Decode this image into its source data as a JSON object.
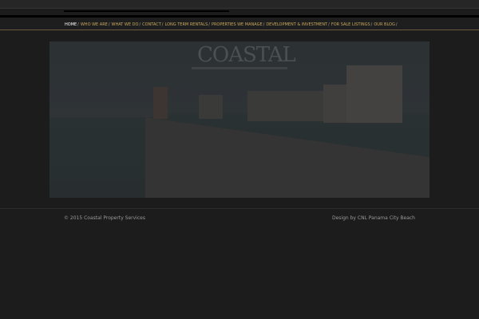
{
  "nav": {
    "items": [
      "HOME",
      "WHO WE ARE",
      "WHAT WE DO",
      "CONTACT",
      "LONG TERM RENTALS",
      "PROPERTIES WE MANAGE",
      "DEVELOPMENT & INVESTMENT",
      "FOR SALE LISTINGS",
      "OUR BLOG"
    ],
    "separator": "/"
  },
  "hero": {
    "logo_text": "COASTAL"
  },
  "footer": {
    "copyright": "© 2015 Coastal Property Services",
    "credit": "Design by CNL Panama City Beach"
  }
}
